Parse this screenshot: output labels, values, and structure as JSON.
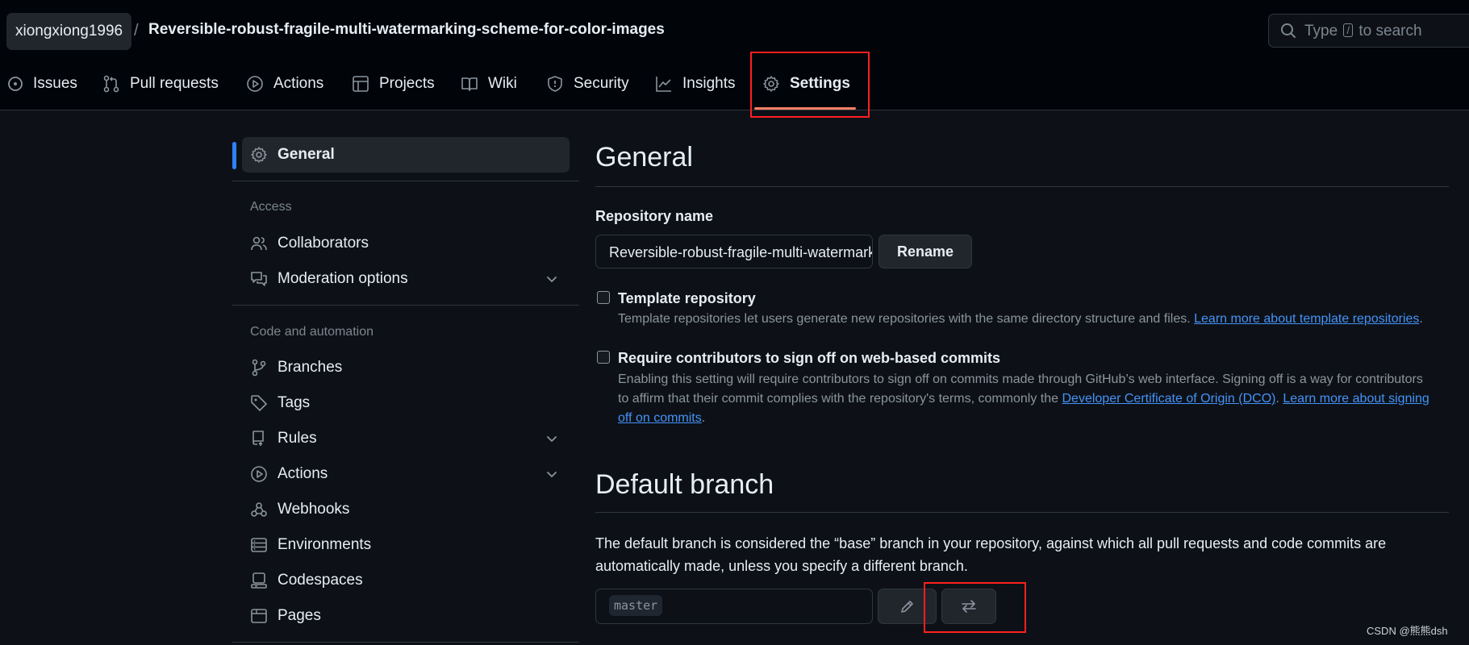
{
  "header": {
    "owner": "xiongxiong1996",
    "separator": "/",
    "repo": "Reversible-robust-fragile-multi-watermarking-scheme-for-color-images",
    "search": {
      "pre": "Type",
      "key": "/",
      "post": "to search"
    }
  },
  "tabs": [
    {
      "label": "Issues",
      "icon": "issue-opened-icon"
    },
    {
      "label": "Pull requests",
      "icon": "git-pull-request-icon"
    },
    {
      "label": "Actions",
      "icon": "play-icon"
    },
    {
      "label": "Projects",
      "icon": "table-icon"
    },
    {
      "label": "Wiki",
      "icon": "book-icon"
    },
    {
      "label": "Security",
      "icon": "shield-icon"
    },
    {
      "label": "Insights",
      "icon": "graph-icon"
    },
    {
      "label": "Settings",
      "icon": "gear-icon",
      "active": true
    }
  ],
  "sidebar": {
    "general": "General",
    "access_heading": "Access",
    "access": [
      {
        "label": "Collaborators",
        "icon": "people-icon"
      },
      {
        "label": "Moderation options",
        "icon": "comment-discussion-icon",
        "expandable": true
      }
    ],
    "code_heading": "Code and automation",
    "code": [
      {
        "label": "Branches",
        "icon": "git-branch-icon"
      },
      {
        "label": "Tags",
        "icon": "tag-icon"
      },
      {
        "label": "Rules",
        "icon": "repo-push-icon",
        "expandable": true
      },
      {
        "label": "Actions",
        "icon": "play-icon",
        "expandable": true
      },
      {
        "label": "Webhooks",
        "icon": "webhook-icon"
      },
      {
        "label": "Environments",
        "icon": "server-icon"
      },
      {
        "label": "Codespaces",
        "icon": "codespaces-icon"
      },
      {
        "label": "Pages",
        "icon": "browser-icon"
      }
    ]
  },
  "main": {
    "title": "General",
    "repo_name_label": "Repository name",
    "repo_name_value": "Reversible-robust-fragile-multi-watermarking-scheme-for-color-images",
    "rename_button": "Rename",
    "template": {
      "title": "Template repository",
      "desc": "Template repositories let users generate new repositories with the same directory structure and files.",
      "link": "Learn more about template repositories",
      "tail": "."
    },
    "signoff": {
      "title": "Require contributors to sign off on web-based commits",
      "desc": "Enabling this setting will require contributors to sign off on commits made through GitHub’s web interface. Signing off is a way for contributors to affirm that their commit complies with the repository's terms, commonly the",
      "link1": "Developer Certificate of Origin (DCO)",
      "mid": ".",
      "link2": "Learn more about signing off on commits",
      "tail": "."
    },
    "default_branch": {
      "title": "Default branch",
      "desc": "The default branch is considered the “base” branch in your repository, against which all pull requests and code commits are automatically made, unless you specify a different branch.",
      "branch": "master"
    }
  },
  "watermark": "CSDN @熊熊dsh",
  "colors": {
    "background": "#0d1117",
    "header": "#010409",
    "accent_underline": "#f78166",
    "link": "#4493f8",
    "selected_bar": "#2f81f7",
    "annotation": "#ff1f1f"
  }
}
